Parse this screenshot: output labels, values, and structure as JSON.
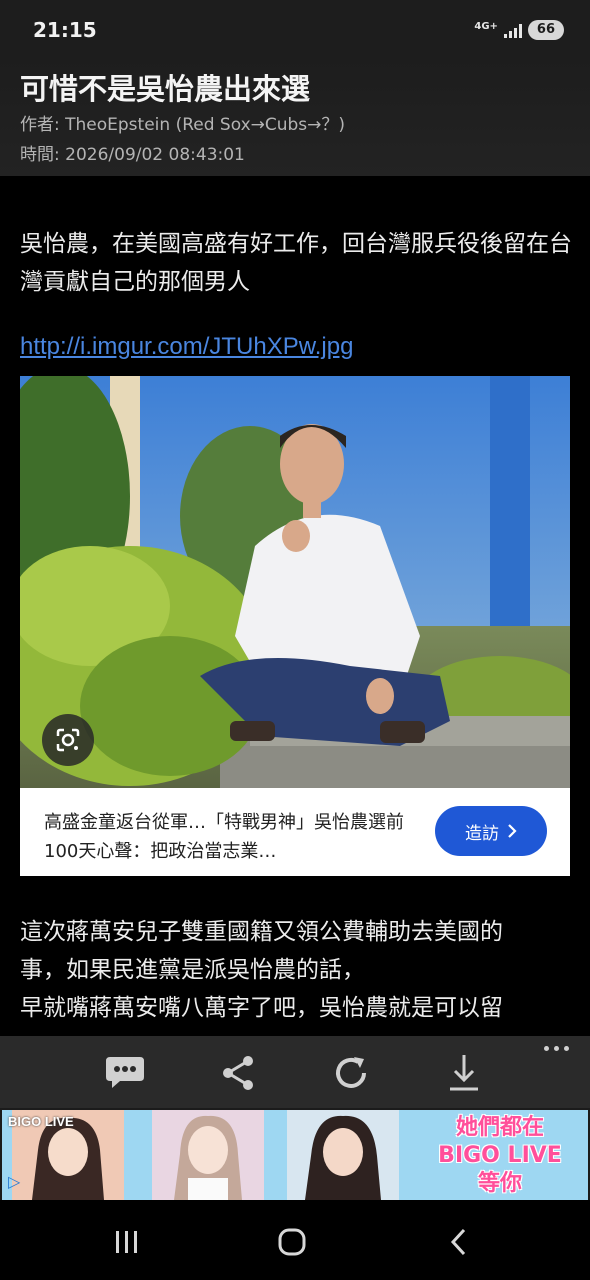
{
  "status_bar": {
    "time": "21:15",
    "network": "4G+",
    "battery": "66"
  },
  "post": {
    "title": "可惜不是吳怡農出來選",
    "author": "作者: TheoEpstein (Red Sox→Cubs→？)",
    "time": "時間: 2026/09/02 08:43:01",
    "paragraph_1": "吳怡農，在美國高盛有好工作，回台灣服兵役後留在台灣貢獻自己的那個男人",
    "link": "http://i.imgur.com/JTUhXPw.jpg",
    "image_card": {
      "caption": "高盛金童返台從軍…「特戰男神」吳怡農選前100天心聲：把政治當志業…",
      "visit_label": "造訪",
      "lens_icon": "google-lens-icon"
    },
    "paragraph_2_lines": [
      "這次蔣萬安兒子雙重國籍又領公費輔助去美國的",
      "事，如果民進黨是派吳怡農的話，",
      "早就嘴蔣萬安嘴八萬字了吧，吳怡農就是可以留"
    ]
  },
  "toolbar": {
    "icons": [
      "comment-icon",
      "share-icon",
      "refresh-icon",
      "download-icon",
      "more-icon"
    ]
  },
  "ad": {
    "logo": "BIGO LIVE",
    "text_lines": [
      "她們都在",
      "BIGO LIVE",
      "等你"
    ]
  },
  "colors": {
    "link": "#4a86e0",
    "visit_button": "#1f58d6",
    "ad_text": "#ff4f9a",
    "header_bg": "#1d1d1d"
  }
}
